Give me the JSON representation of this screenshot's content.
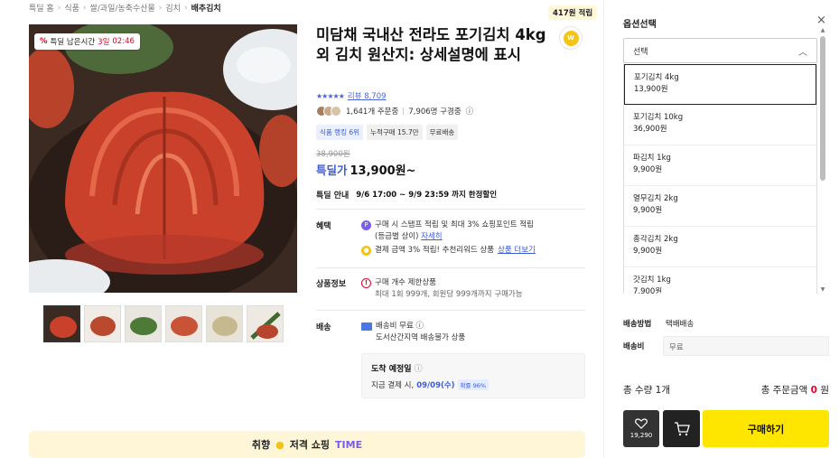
{
  "breadcrumb": [
    "특딜 홈",
    "식품",
    "쌀/과일/농축수산물",
    "김치",
    "배추김치"
  ],
  "points_badge": "417원 적립",
  "brand_logo_text": "W",
  "timer": {
    "label": "특딜 남은시간",
    "days": "3일",
    "time": "02:46"
  },
  "product": {
    "title": "미담채 국내산 전라도 포기김치 4kg 외 김치 원산지: 상세설명에 표시",
    "review_label": "리뷰 8,709",
    "orders": "1,641개 주문중",
    "buyers": "7,906명 구경중",
    "tags": [
      "식품 랭킹 6위",
      "누적구매 15.7만",
      "무료배송"
    ],
    "original_price": "38,900원",
    "price_label": "특딜가",
    "price": "13,900원~"
  },
  "sale": {
    "label": "특딜 안내",
    "value": "9/6 17:00 ~ 9/9 23:59 까지 한정할인"
  },
  "benefit": {
    "label": "혜택",
    "line1": "구매 시 스탬프 적립 및 최대 3% 쇼핑포인트 적립",
    "line2": "(등급별 상이)",
    "line2_link": "자세히",
    "line3": "결제 금액 3% 적립! 추천리워드 상품",
    "line3_link": "상품 더보기"
  },
  "product_info": {
    "label": "상품정보",
    "line1": "구매 개수 제한상품",
    "line2": "최대 1회 999개, 회원당 999개까지 구매가능"
  },
  "shipping": {
    "label": "배송",
    "line1": "배송비 무료",
    "line2": "도서산간지역 배송불가 상품",
    "arrival_title": "도착 예정일",
    "arrival_prefix": "지금 결제 시,",
    "arrival_date": "09/09(수)",
    "arrival_pill": "확률 96%"
  },
  "banner": {
    "text1": "취향",
    "text2": "저격 쇼핑",
    "text3": "TIME"
  },
  "options": {
    "title": "옵션선택",
    "select_placeholder": "선택",
    "items": [
      {
        "name": "포기김치 4kg",
        "price": "13,900원"
      },
      {
        "name": "포기김치 10kg",
        "price": "36,900원"
      },
      {
        "name": "파김치 1kg",
        "price": "9,900원"
      },
      {
        "name": "열무김치 2kg",
        "price": "9,900원"
      },
      {
        "name": "총각김치 2kg",
        "price": "9,900원"
      },
      {
        "name": "갓김치 1kg",
        "price": "7,900원"
      }
    ]
  },
  "ship_method": {
    "label": "배송방법",
    "value": "택배배송"
  },
  "ship_fee": {
    "label": "배송비",
    "value": "무료"
  },
  "totals": {
    "qty_label": "총 수량",
    "qty": "1개",
    "amount_label": "총 주문금액",
    "amount": "0",
    "unit": "원"
  },
  "like_count": "19,290",
  "buy_label": "구매하기",
  "colors": {
    "accent_blue": "#3b5bdb",
    "buy_yellow": "#ffe600",
    "sale_red": "#e5002b"
  }
}
